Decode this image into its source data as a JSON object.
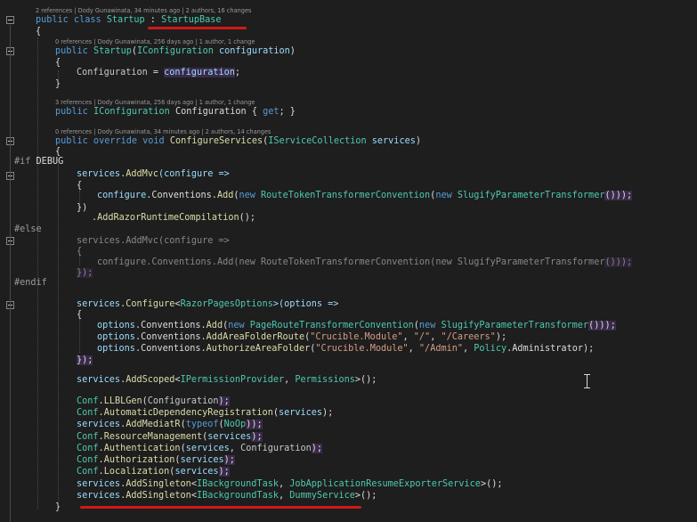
{
  "codelens": {
    "startup_class": "2 references | Dody Gunawinata, 34 minutes ago | 2 authors, 16 changes",
    "startup_ctor": "0 references | Dody Gunawinata, 256 days ago | 1 author, 1 change",
    "configuration_prop": "3 references | Dody Gunawinata, 256 days ago | 1 author, 1 change",
    "configure_services": "0 references | Dody Gunawinata, 34 minutes ago | 2 authors, 14 changes"
  },
  "code": {
    "l_class_kw": "public class ",
    "l_class_name": "Startup",
    "l_class_sep": " : ",
    "l_class_base": "StartupBase",
    "l_brace_open": "{",
    "l_ctor_kw": "public ",
    "l_ctor_name": "Startup",
    "l_ctor_p1": "(",
    "l_ctor_type": "IConfiguration",
    "l_ctor_param": " configuration",
    "l_ctor_p2": ")",
    "l_assign_prop": "Configuration",
    "l_assign_eq": " = ",
    "l_assign_val": "configuration",
    "l_assign_end": ";",
    "l_brace_close": "}",
    "l_prop_kw": "public ",
    "l_prop_type": "IConfiguration",
    "l_prop_name": " Configuration { ",
    "l_prop_get": "get",
    "l_prop_end": "; }",
    "l_cs_kw": "public override void ",
    "l_cs_name": "ConfigureServices",
    "l_cs_p1": "(",
    "l_cs_type": "IServiceCollection",
    "l_cs_param": " services",
    "l_cs_p2": ")",
    "pp_if": "#if ",
    "pp_if_sym": "DEBUG",
    "pp_else": "#else",
    "pp_endif": "#endif",
    "services": "services",
    "conf": "Conf",
    "options": "options",
    "configure": "configure",
    "addmvc": "AddMvc",
    "addmvc_args": "(configure =>",
    "conv_add": ".Conventions.",
    "add": "Add",
    "new_kw": "new ",
    "route_conv": "RouteTokenTransformerConvention",
    "slugify": "SlugifyParameterTransformer",
    "close_conv_1": "()));",
    "close_lambda": "})",
    "close_lambda_semi": "});",
    "razor_compile": ".AddRazorRuntimeCompilation",
    "razor_compile_end": "();",
    "cfg_method": "Configure",
    "razor_opts": "RazorPagesOptions",
    "cfg_args": ">(options =>",
    "page_route_conv": "PageRouteTransformerConvention",
    "add_area_route": "AddAreaFolderRoute",
    "auth_area_folder": "AuthorizeAreaFolder",
    "str_module": "\"Crucible.Module\"",
    "str_slash": "\"/\"",
    "str_careers": "\"/Careers\"",
    "str_admin": "\"/Admin\"",
    "policy": "Policy",
    "administrator": "Administrator",
    "add_scoped": "AddScoped",
    "iperm_provider": "IPermissionProvider",
    "permissions": "Permissions",
    "llblgen": "LLBLGen",
    "arg_configuration": "Configuration",
    "auto_dep_reg": "AutomaticDependencyRegistration",
    "arg_services": "services",
    "add_mediatr": "AddMediatR",
    "typeof_kw": "typeof",
    "noop": "NoOp",
    "resource_mgmt": "ResourceManagement",
    "authentication": "Authentication",
    "authorization": "Authorization",
    "localization": "Localization",
    "add_singleton": "AddSingleton",
    "ibg_task": "IBackgroundTask",
    "job_resume_svc": "JobApplicationResumeExporterService",
    "dummy_svc": "DummyService"
  },
  "colors": {
    "background": "#1e1e1e",
    "keyword": "#569cd6",
    "type": "#4ec9b0",
    "method": "#dcdcaa",
    "string": "#d69d85",
    "squiggle": "#d01818"
  }
}
